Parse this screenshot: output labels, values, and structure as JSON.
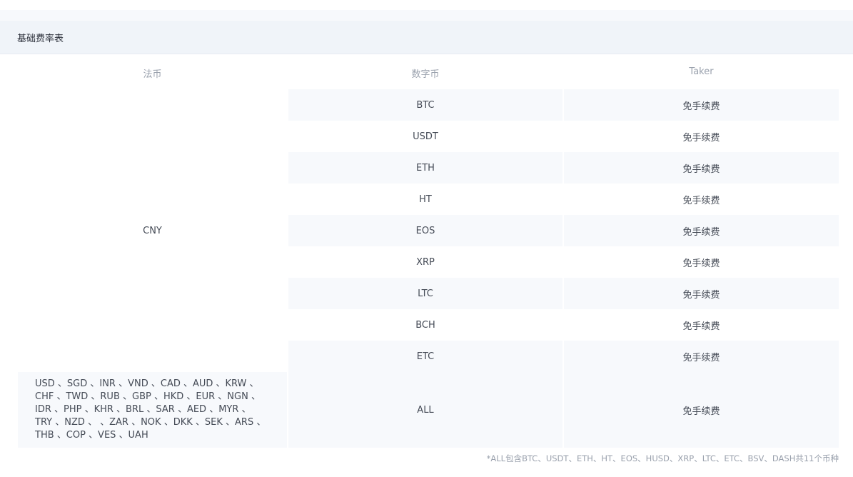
{
  "section": {
    "title": "基础费率表"
  },
  "table": {
    "headers": {
      "fiat": "法币",
      "crypto": "数字币",
      "taker": "Taker"
    },
    "cny_label": "CNY",
    "rows": [
      {
        "coin": "BTC",
        "taker": "免手续费"
      },
      {
        "coin": "USDT",
        "taker": "免手续费"
      },
      {
        "coin": "ETH",
        "taker": "免手续费"
      },
      {
        "coin": "HT",
        "taker": "免手续费"
      },
      {
        "coin": "EOS",
        "taker": "免手续费"
      },
      {
        "coin": "XRP",
        "taker": "免手续费"
      },
      {
        "coin": "LTC",
        "taker": "免手续费"
      },
      {
        "coin": "BCH",
        "taker": "免手续费"
      },
      {
        "coin": "ETC",
        "taker": "免手续费"
      }
    ],
    "other_fiat_lines": [
      "USD 、SGD 、INR 、VND 、CAD 、AUD 、KRW 、",
      "CHF 、TWD 、RUB 、GBP 、HKD 、EUR 、NGN 、",
      "IDR 、PHP 、KHR 、BRL 、SAR 、AED 、MYR 、",
      "TRY 、NZD 、 、ZAR 、NOK 、DKK 、SEK 、ARS 、",
      "THB 、COP 、VES 、UAH"
    ],
    "all_row": {
      "coin": "ALL",
      "taker": "免手续费"
    }
  },
  "footnote": "*ALL包含BTC、USDT、ETH、HT、EOS、HUSD、XRP、LTC、ETC、BSV、DASH共11个币种"
}
